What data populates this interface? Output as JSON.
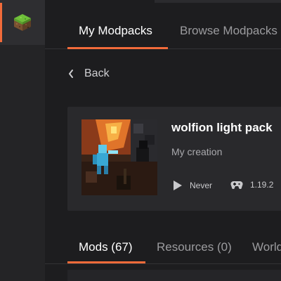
{
  "sidebar": {
    "game_icon": "minecraft-grass-block-icon",
    "accent_color": "#f26b3a"
  },
  "top_tabs": [
    {
      "label": "My Modpacks",
      "active": true
    },
    {
      "label": "Browse Modpacks",
      "active": false
    }
  ],
  "back": {
    "label": "Back",
    "icon": "chevron-left-icon"
  },
  "modpack": {
    "name": "wolfion light pack",
    "description": "My creation",
    "last_played": "Never",
    "game_version": "1.19.2",
    "play_icon": "play-icon",
    "version_icon": "gamepad-icon"
  },
  "sub_tabs": [
    {
      "label": "Mods (67)",
      "active": true
    },
    {
      "label": "Resources (0)",
      "active": false
    },
    {
      "label": "Worlds",
      "active": false
    }
  ]
}
